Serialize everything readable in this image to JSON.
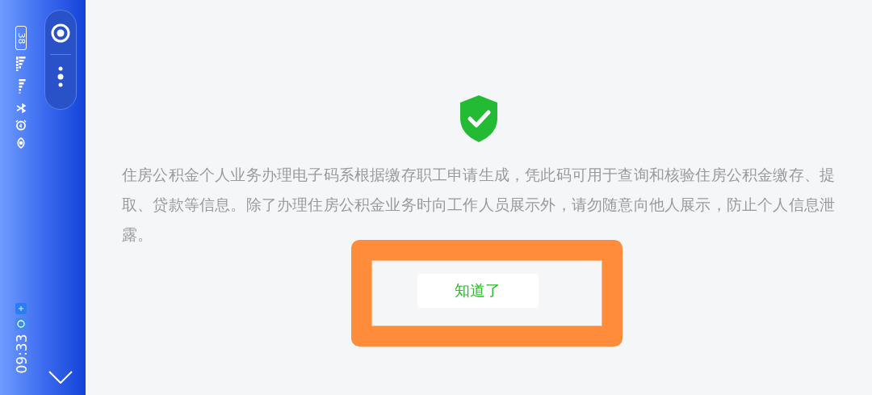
{
  "status_bar": {
    "battery": "38",
    "time": "09:33"
  },
  "notice": {
    "text": "住房公积金个人业务办理电子码系根据缴存职工申请生成，凭此码可用于查询和核验住房公积金缴存、提取、贷款等信息。除了办理住房公积金业务时向工作人员展示外，请勿随意向他人展示，防止个人信息泄露。",
    "button": "知道了",
    "highlighted": true
  }
}
